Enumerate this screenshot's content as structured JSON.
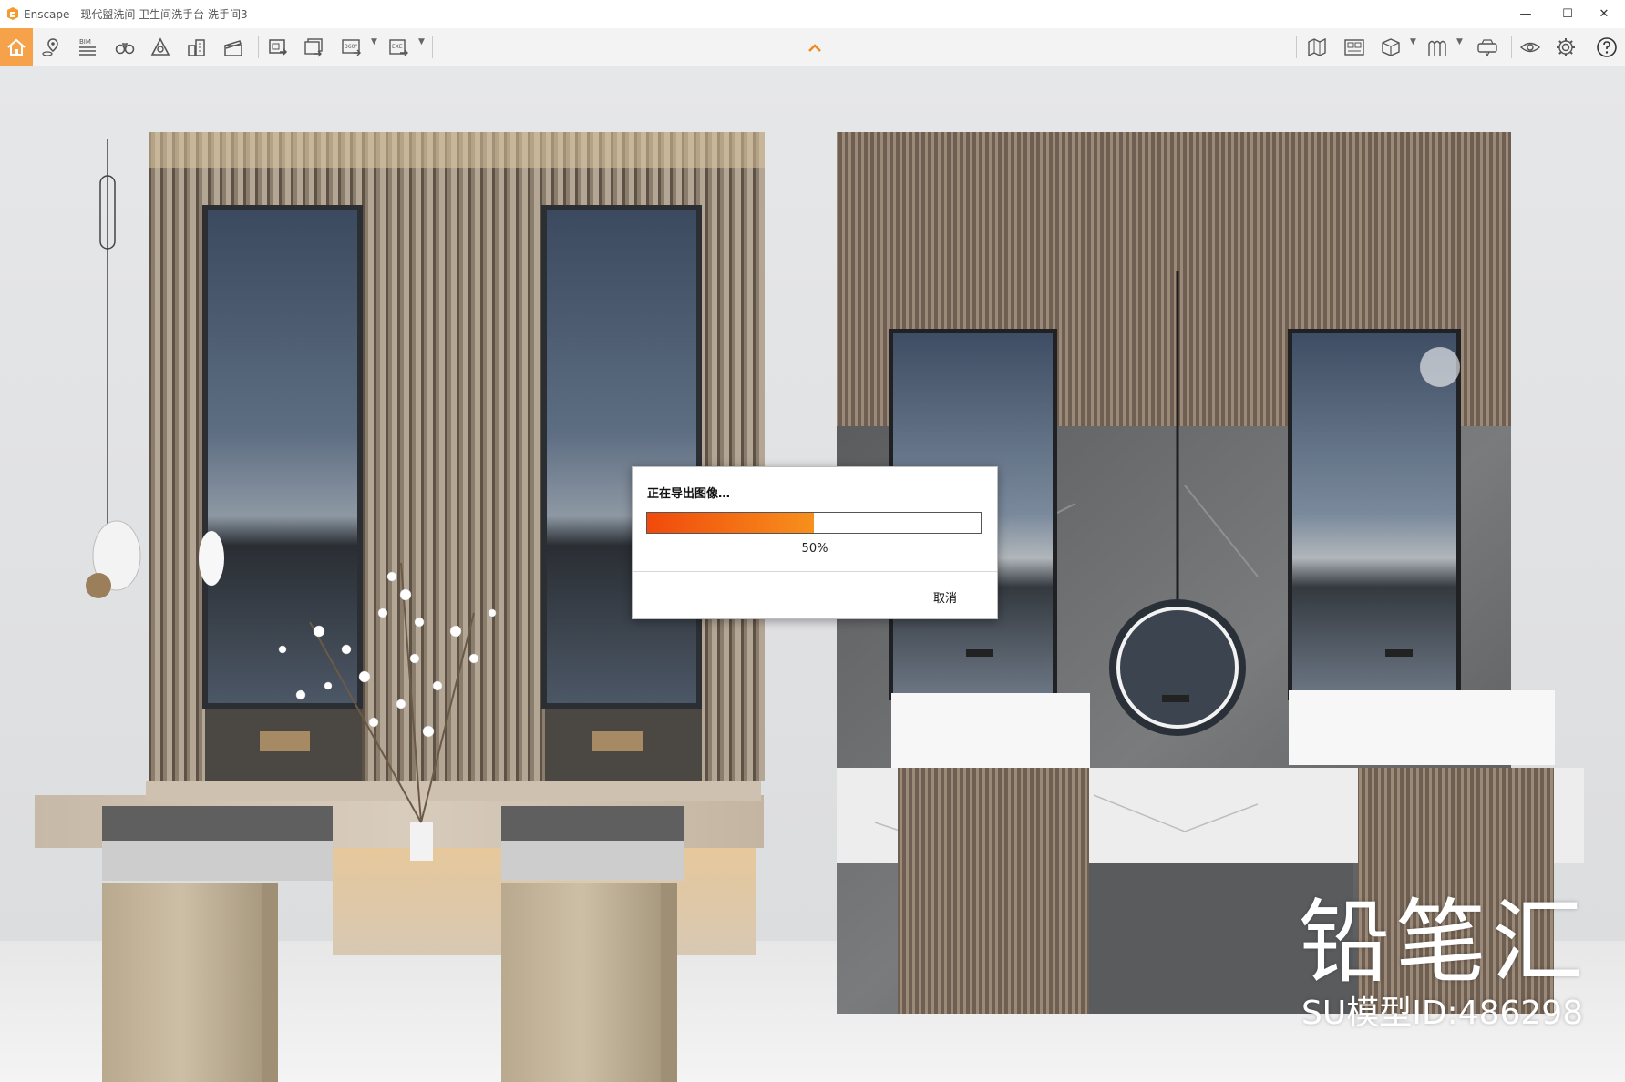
{
  "window": {
    "title": "Enscape - 现代盥洗间 卫生间洗手台 洗手间3",
    "minimize_label": "—",
    "maximize_label": "☐",
    "close_label": "✕"
  },
  "toolbar": {
    "accent_color": "#f5a24a",
    "left_tools": [
      {
        "icon": "home-icon"
      },
      {
        "icon": "location-pin-icon"
      },
      {
        "icon": "bim-icon",
        "label": "BIM"
      },
      {
        "icon": "binoculars-icon"
      },
      {
        "icon": "sun-shape-icon"
      },
      {
        "icon": "buildings-icon"
      },
      {
        "icon": "clapperboard-icon"
      },
      {
        "icon": "screenshot-export-icon"
      },
      {
        "icon": "batch-render-icon"
      },
      {
        "icon": "panorama-360-icon",
        "label": "360°"
      },
      {
        "icon": "exe-export-icon",
        "label": "EXE"
      }
    ],
    "right_tools": [
      {
        "icon": "map-icon"
      },
      {
        "icon": "asset-library-icon"
      },
      {
        "icon": "cube-view-icon"
      },
      {
        "icon": "materials-icon"
      },
      {
        "icon": "vr-headset-icon"
      },
      {
        "icon": "visual-settings-icon"
      },
      {
        "icon": "gear-icon"
      },
      {
        "icon": "help-icon"
      }
    ]
  },
  "export_dialog": {
    "title": "正在导出图像…",
    "progress_fraction": 0.5,
    "progress_label": "50%",
    "cancel_label": "取消",
    "progress_colors": [
      "#f04a0c",
      "#f7901c"
    ]
  },
  "overlay": {
    "brand_text": "铅笔汇",
    "model_id_text": "SU模型ID:486298"
  }
}
